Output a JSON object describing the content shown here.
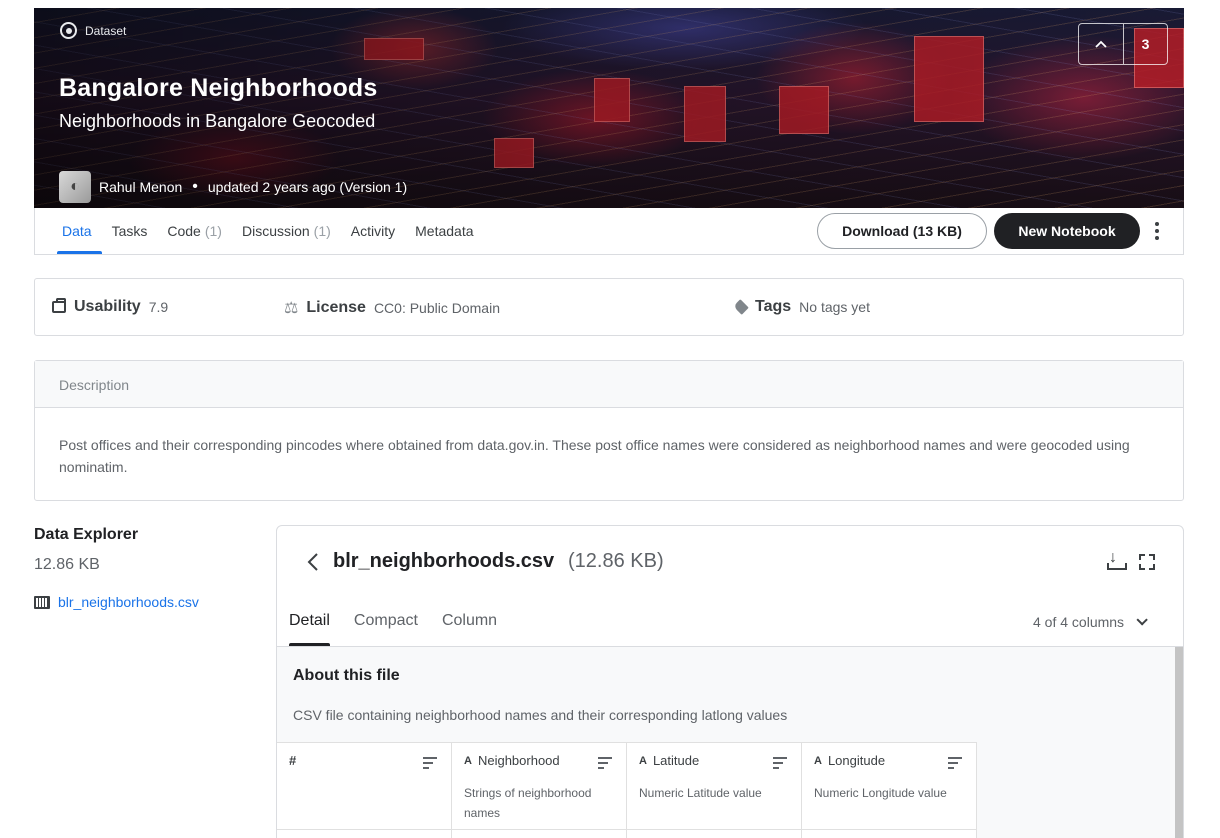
{
  "hero": {
    "badge": "Dataset",
    "title": "Bangalore Neighborhoods",
    "subtitle": "Neighborhoods in Bangalore Geocoded",
    "author": "Rahul Menon",
    "updated": "updated 2 years ago (Version 1)",
    "vote_count": "3",
    "icons": {
      "badge": "dataset-icon",
      "vote": "chevron-up-icon"
    }
  },
  "tabs": [
    {
      "label": "Data",
      "count": ""
    },
    {
      "label": "Tasks",
      "count": ""
    },
    {
      "label": "Code",
      "count": "(1)"
    },
    {
      "label": "Discussion",
      "count": "(1)"
    },
    {
      "label": "Activity",
      "count": ""
    },
    {
      "label": "Metadata",
      "count": ""
    }
  ],
  "actions": {
    "download": "Download (13 KB)",
    "new_notebook": "New Notebook"
  },
  "info": {
    "usability_label": "Usability",
    "usability_value": "7.9",
    "license_label": "License",
    "license_value": "CC0: Public Domain",
    "tags_label": "Tags",
    "tags_value": "No tags yet"
  },
  "description": {
    "header": "Description",
    "text": "Post offices and their corresponding pincodes where obtained from data.gov.in. These post office names were considered as neighborhood names and were geocoded using nominatim."
  },
  "explorer": {
    "title": "Data Explorer",
    "size": "12.86 KB",
    "file": "blr_neighborhoods.csv"
  },
  "file_panel": {
    "name": "blr_neighborhoods.csv",
    "size": "(12.86 KB)",
    "tabs": [
      "Detail",
      "Compact",
      "Column"
    ],
    "column_selector": "4 of 4 columns",
    "about_title": "About this file",
    "about_text": "CSV file containing neighborhood names and their corresponding latlong values",
    "columns": [
      {
        "type": "#",
        "name": "",
        "desc": ""
      },
      {
        "type": "A",
        "name": "Neighborhood",
        "desc": "Strings of neighborhood names"
      },
      {
        "type": "A",
        "name": "Latitude",
        "desc": "Numeric Latitude value"
      },
      {
        "type": "A",
        "name": "Longitude",
        "desc": "Numeric Longitude value"
      }
    ]
  },
  "colors": {
    "accent": "#1a73e8",
    "dark_button": "#202124"
  }
}
